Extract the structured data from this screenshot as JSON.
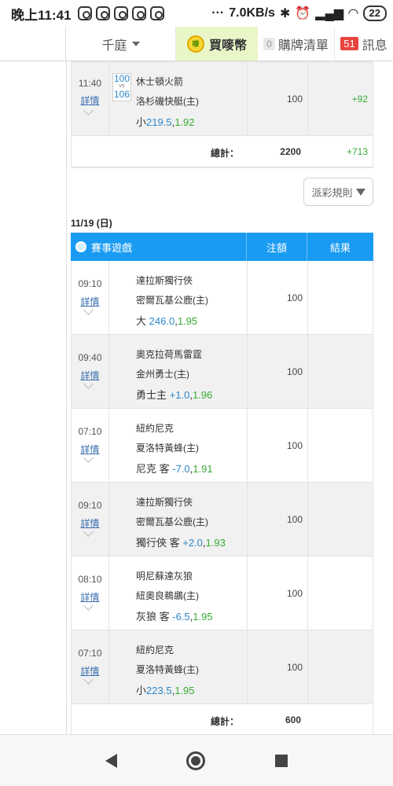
{
  "statusbar": {
    "time": "晚上11:41",
    "speed": "7.0KB/s",
    "dots": "···",
    "battery": "22"
  },
  "nav": {
    "user": "千庭",
    "buy_label": "買嘜幣",
    "coin_text": "嘜",
    "cart_count": "0",
    "cart_label": "購牌清單",
    "msg_count": "51",
    "msg_label": "訊息"
  },
  "top_section": {
    "row": {
      "time": "11:40",
      "detail": "詳情",
      "away_score": "100",
      "vs": "vs",
      "home_score": "106",
      "away": "休士頓火箭",
      "home": "洛杉磯快艇(主)",
      "bet_label": "小",
      "bet_line": "219.5",
      "bet_odds": "1.92",
      "amount": "100",
      "result": "+92"
    },
    "total": {
      "label": "總計：",
      "amount": "2200",
      "result": "+713"
    }
  },
  "rule_button": "派彩規則",
  "date": "11/19 (日)",
  "table_header": {
    "game": "賽事遊戲",
    "amount": "注額",
    "result": "結果"
  },
  "games": [
    {
      "time": "09:10",
      "detail": "詳情",
      "away": "達拉斯獨行俠",
      "home": "密爾瓦基公鹿(主)",
      "bet_label": "大",
      "bet_line": "246.0",
      "bet_odds": "1.95",
      "amount": "100"
    },
    {
      "time": "09:40",
      "detail": "詳情",
      "away": "奧克拉荷馬雷霆",
      "home": "金州勇士(主)",
      "bet_label": "勇士主",
      "bet_line": "+1.0",
      "bet_odds": "1.96",
      "amount": "100"
    },
    {
      "time": "07:10",
      "detail": "詳情",
      "away": "紐約尼克",
      "home": "夏洛特黃蜂(主)",
      "bet_label": "尼克 客",
      "bet_line": "-7.0",
      "bet_odds": "1.91",
      "amount": "100"
    },
    {
      "time": "09:10",
      "detail": "詳情",
      "away": "達拉斯獨行俠",
      "home": "密爾瓦基公鹿(主)",
      "bet_label": "獨行俠 客",
      "bet_line": "+2.0",
      "bet_odds": "1.93",
      "amount": "100"
    },
    {
      "time": "08:10",
      "detail": "詳情",
      "away": "明尼蘇達灰狼",
      "home": "紐奧良鵜鶘(主)",
      "bet_label": "灰狼 客",
      "bet_line": "-6.5",
      "bet_odds": "1.95",
      "amount": "100"
    },
    {
      "time": "07:10",
      "detail": "詳情",
      "away": "紐約尼克",
      "home": "夏洛特黃蜂(主)",
      "bet_label": "小",
      "bet_line": "223.5",
      "bet_odds": "1.95",
      "amount": "100"
    }
  ],
  "bottom_total": {
    "label": "總計：",
    "amount": "600"
  },
  "colors": {
    "accent": "#1a9bf2",
    "positive": "#3aaa35",
    "line": "#2c87c9"
  }
}
